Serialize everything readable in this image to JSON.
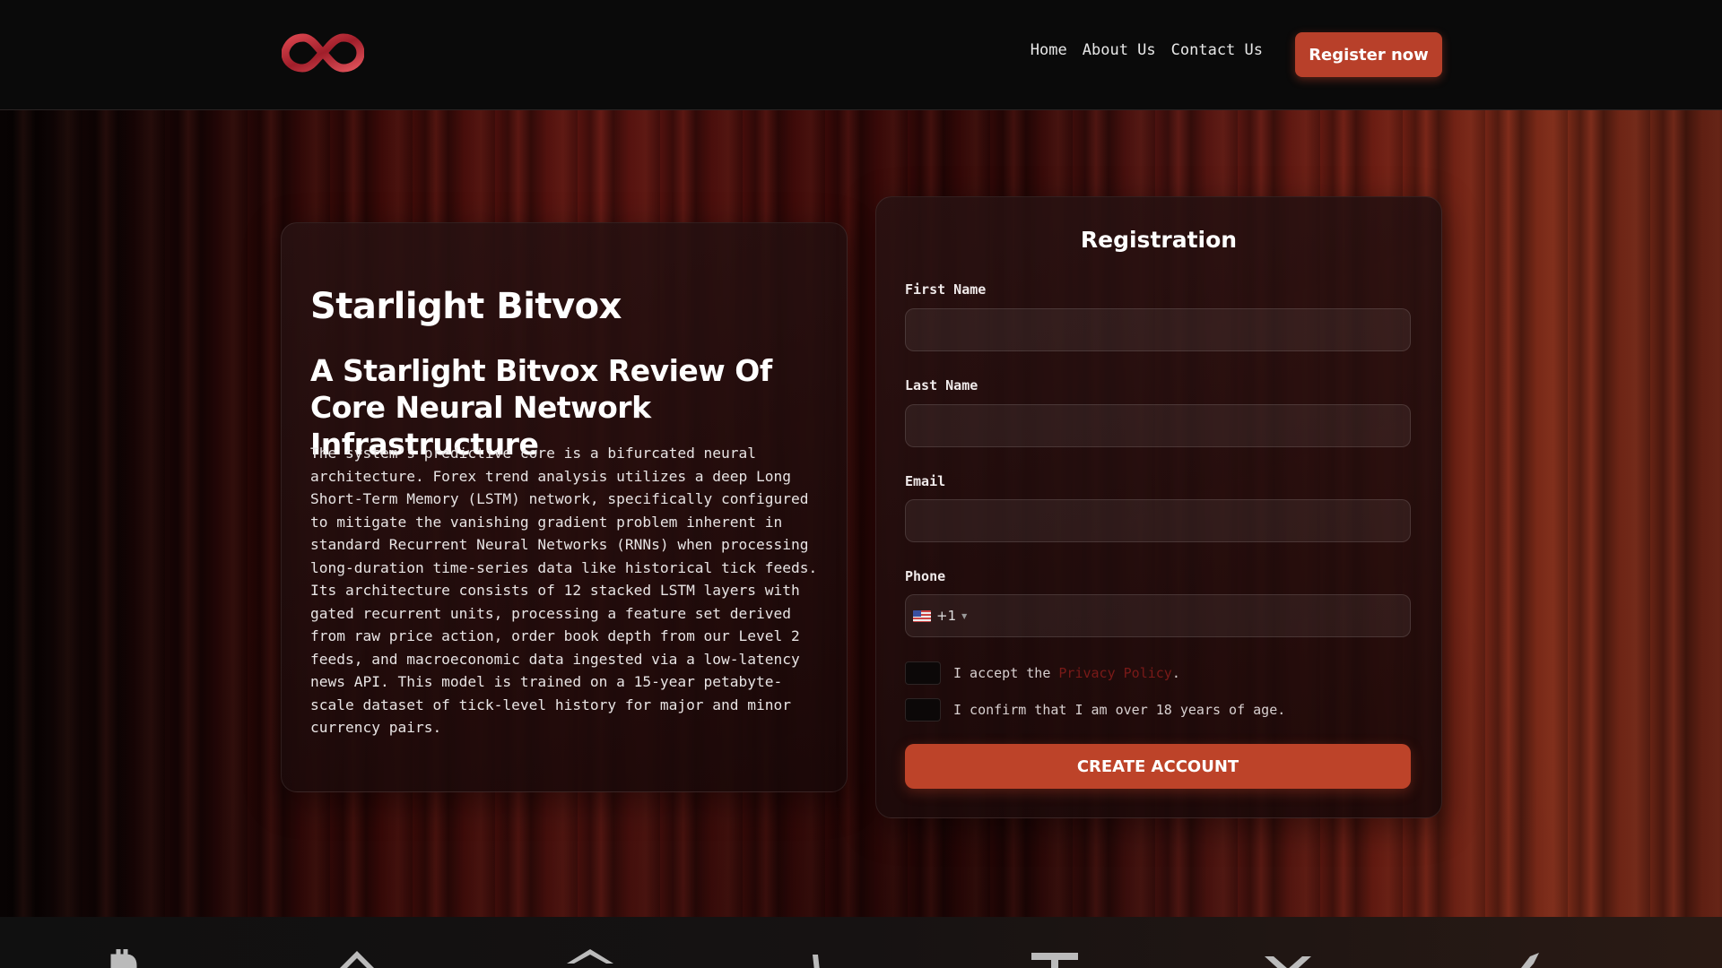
{
  "header": {
    "nav": [
      "Home",
      "About Us",
      "Contact Us"
    ],
    "register_label": "Register now"
  },
  "info": {
    "title": "Starlight Bitvox",
    "subtitle": "A Starlight Bitvox Review Of Core Neural Network Infrastructure",
    "body": "The system’s predictive core is a bifurcated neural architecture. Forex trend analysis utilizes a deep Long Short-Term Memory (LSTM) network, specifically configured to mitigate the vanishing gradient problem inherent in standard Recurrent Neural Networks (RNNs) when processing long-duration time-series data like historical tick feeds. Its architecture consists of 12 stacked LSTM layers with gated recurrent units, processing a feature set derived from raw price action, order book depth from our Level 2 feeds, and macroeconomic data ingested via a low-latency news API. This model is trained on a 15-year petabyte-scale dataset of tick-level history for major and minor currency pairs."
  },
  "form": {
    "title": "Registration",
    "first_name_label": "First Name",
    "first_name_value": "",
    "last_name_label": "Last Name",
    "last_name_value": "",
    "email_label": "Email",
    "email_value": "",
    "phone_label": "Phone",
    "phone_code": "+1",
    "phone_value": "",
    "privacy_prefix": "I accept the ",
    "privacy_link": "Privacy Policy",
    "privacy_suffix": ".",
    "age_text": "I confirm that I am over 18 years of age.",
    "submit_label": "CREATE ACCOUNT"
  },
  "icons": {
    "logo": "infinity-logo",
    "flag": "us-flag-icon",
    "strip": [
      "bitcoin-icon",
      "binance-icon",
      "ethereum-icon",
      "litecoin-icon",
      "tether-icon",
      "xrp-icon",
      "crypto-icon"
    ]
  },
  "colors": {
    "accent": "#bd4329",
    "background": "#0b0b0b"
  }
}
